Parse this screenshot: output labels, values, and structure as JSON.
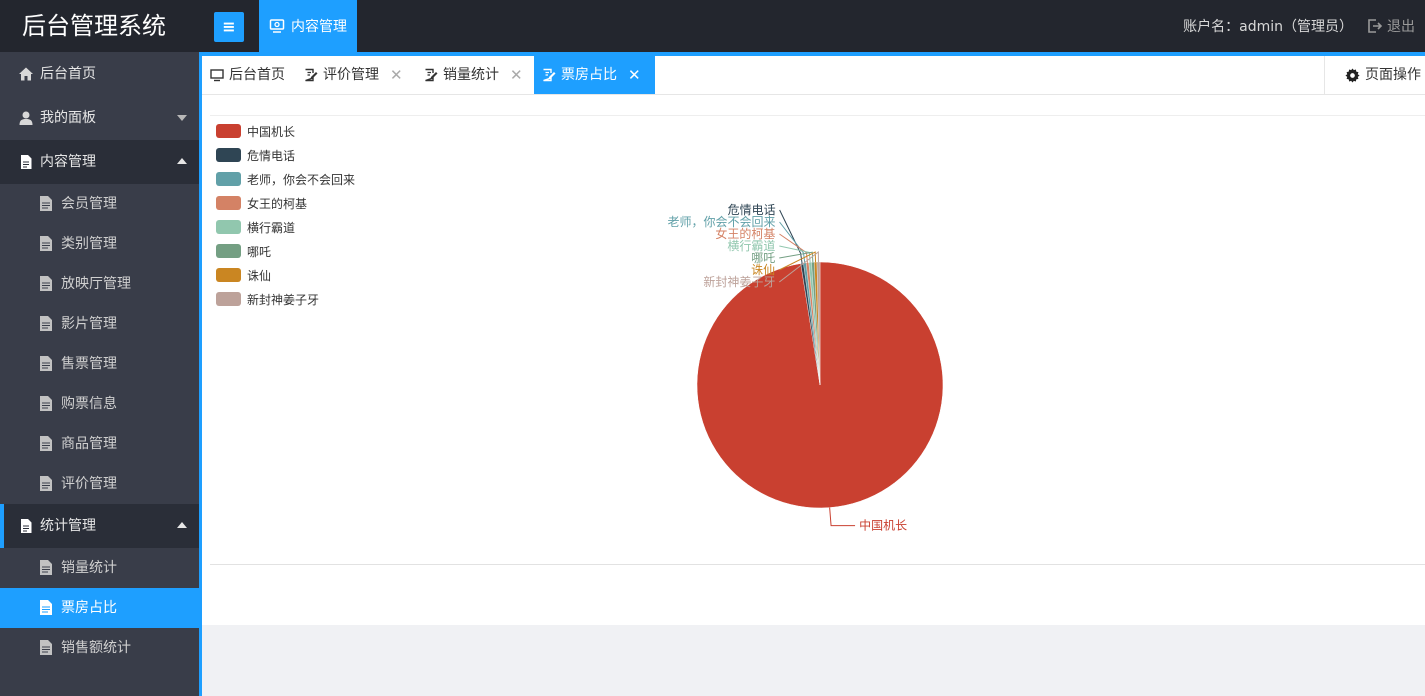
{
  "header": {
    "logo": "后台管理系统",
    "menu_toggle_icon": "hamburger-icon",
    "top_nav_label": "内容管理",
    "account": "账户名：admin（管理员）",
    "logout": "退出"
  },
  "sidebar": {
    "home": "后台首页",
    "my_panel": "我的面板",
    "content_group": "内容管理",
    "content_items": [
      "会员管理",
      "类别管理",
      "放映厅管理",
      "影片管理",
      "售票管理",
      "购票信息",
      "商品管理",
      "评价管理"
    ],
    "stats_group": "统计管理",
    "stats_items": [
      "销量统计",
      "票房占比",
      "销售额统计"
    ]
  },
  "tabs": [
    {
      "label": "后台首页",
      "closable": false,
      "active": false
    },
    {
      "label": "评价管理",
      "closable": true,
      "active": false
    },
    {
      "label": "销量统计",
      "closable": true,
      "active": false
    },
    {
      "label": "票房占比",
      "closable": true,
      "active": true
    }
  ],
  "page_ops": "页面操作",
  "chart_data": {
    "type": "pie",
    "series": [
      {
        "name": "中国机长",
        "value": 97.5,
        "color": "#c94030"
      },
      {
        "name": "危情电话",
        "value": 0.35,
        "color": "#2f4554"
      },
      {
        "name": "老师，你会不会回来",
        "value": 0.35,
        "color": "#61a0a8"
      },
      {
        "name": "女王的柯基",
        "value": 0.35,
        "color": "#d48265"
      },
      {
        "name": "横行霸道",
        "value": 0.35,
        "color": "#91c7ae"
      },
      {
        "name": "哪吒",
        "value": 0.35,
        "color": "#749f83"
      },
      {
        "name": "诛仙",
        "value": 0.35,
        "color": "#ca8622"
      },
      {
        "name": "新封神姜子牙",
        "value": 0.4,
        "color": "#bda29a"
      }
    ],
    "legend_position": "top-left"
  }
}
